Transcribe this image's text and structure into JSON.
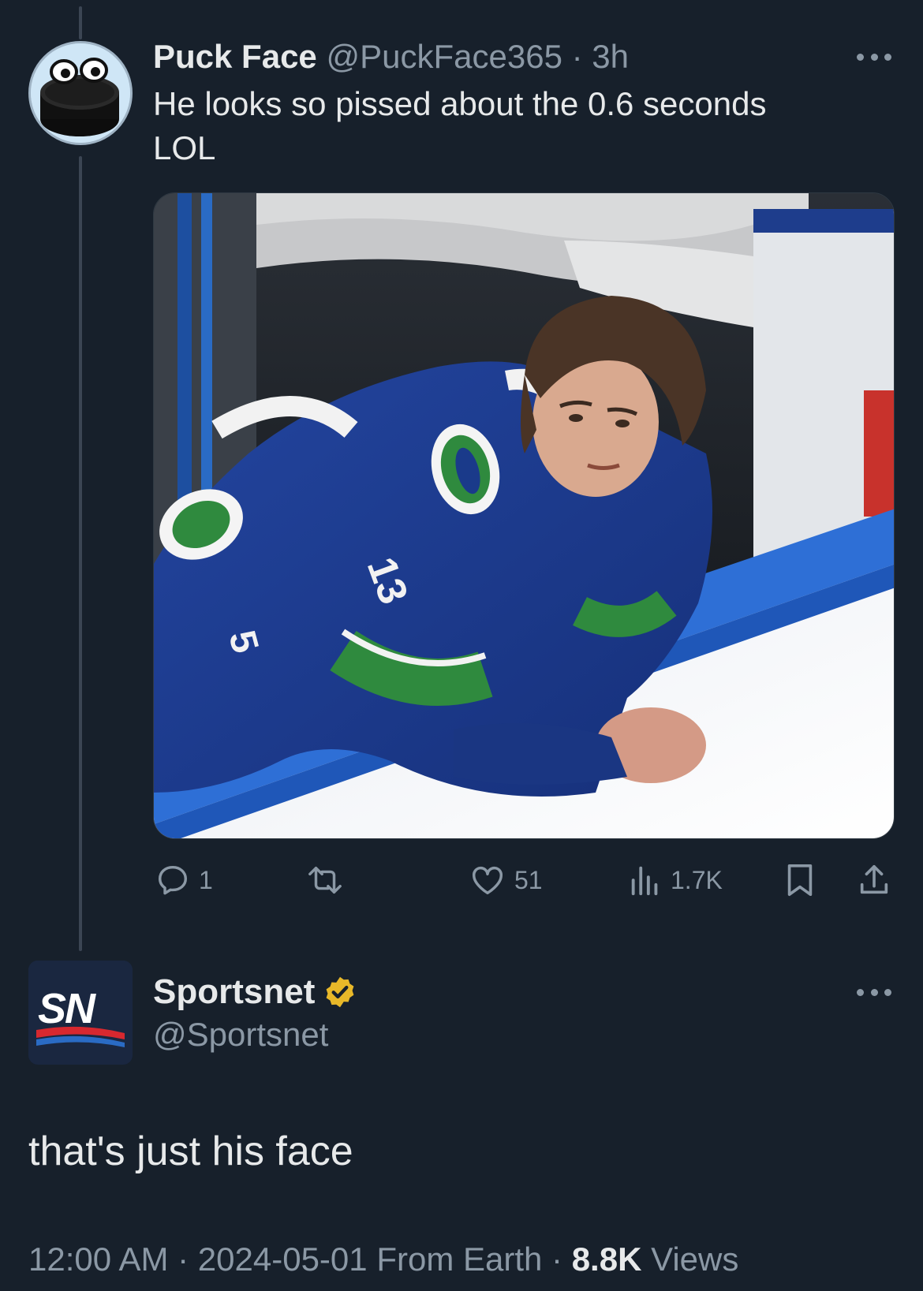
{
  "tweet": {
    "display_name": "Puck Face",
    "handle": "@PuckFace365",
    "separator": "·",
    "time": "3h",
    "text_line1": "He looks so pissed about the 0.6 seconds",
    "text_line2": "LOL",
    "media_icon": "hockey-player-photo",
    "actions": {
      "reply_count": "1",
      "retweet_count": "",
      "like_count": "51",
      "views_count": "1.7K"
    }
  },
  "reply": {
    "display_name": "Sportsnet",
    "handle": "@Sportsnet",
    "verified": true,
    "logo_text": "SN",
    "text": "that's just his face",
    "timestamp": "12:00 AM",
    "date": "2024-05-01",
    "source": "From Earth",
    "views_count": "8.8K",
    "views_label": "Views"
  },
  "colors": {
    "background": "#17202b",
    "text": "#e7e9ea",
    "muted": "#8b98a5",
    "verified_gold": "#e8b829",
    "jersey_blue": "#1f3f9a",
    "jersey_green": "#2f8a3e"
  }
}
